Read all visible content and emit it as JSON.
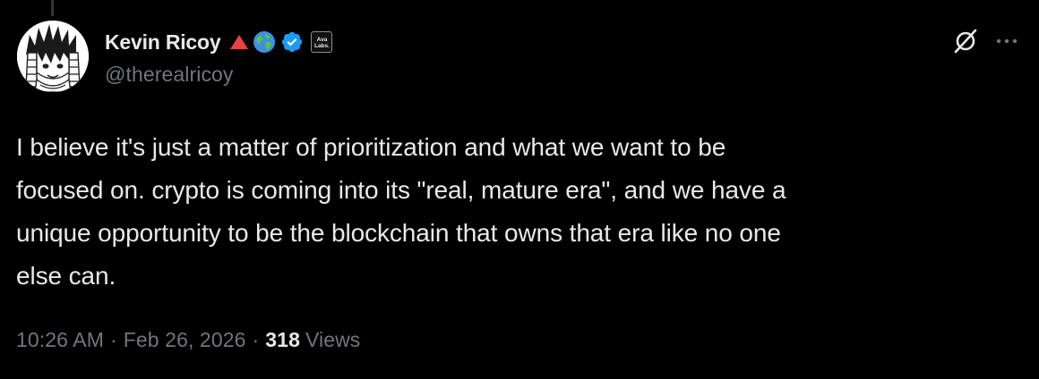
{
  "author": {
    "display_name": "Kevin Ricoy",
    "handle": "@therealricoy",
    "affiliate_badge": {
      "line1": "Ava",
      "line2": "Labs."
    },
    "badges": [
      "red-triangle-icon",
      "globe-icon",
      "verified-icon",
      "affiliate-badge"
    ]
  },
  "tweet": {
    "text": "I believe it's just a matter of prioritization and what we want to be\nfocused on. crypto is coming into its \"real, mature era\", and we have a\nunique opportunity to be the blockchain that owns that era like no one\nelse can."
  },
  "meta": {
    "time": "10:26 AM",
    "separator": "·",
    "date": "Feb 26, 2026",
    "views_count": "318",
    "views_label": "Views"
  },
  "icons": {
    "grok": "grok-icon",
    "more": "more-icon"
  },
  "colors": {
    "background": "#000000",
    "text_primary": "#e7e9ea",
    "text_secondary": "#71767b",
    "verified": "#1d9bf0",
    "triangle": "#e84142"
  }
}
